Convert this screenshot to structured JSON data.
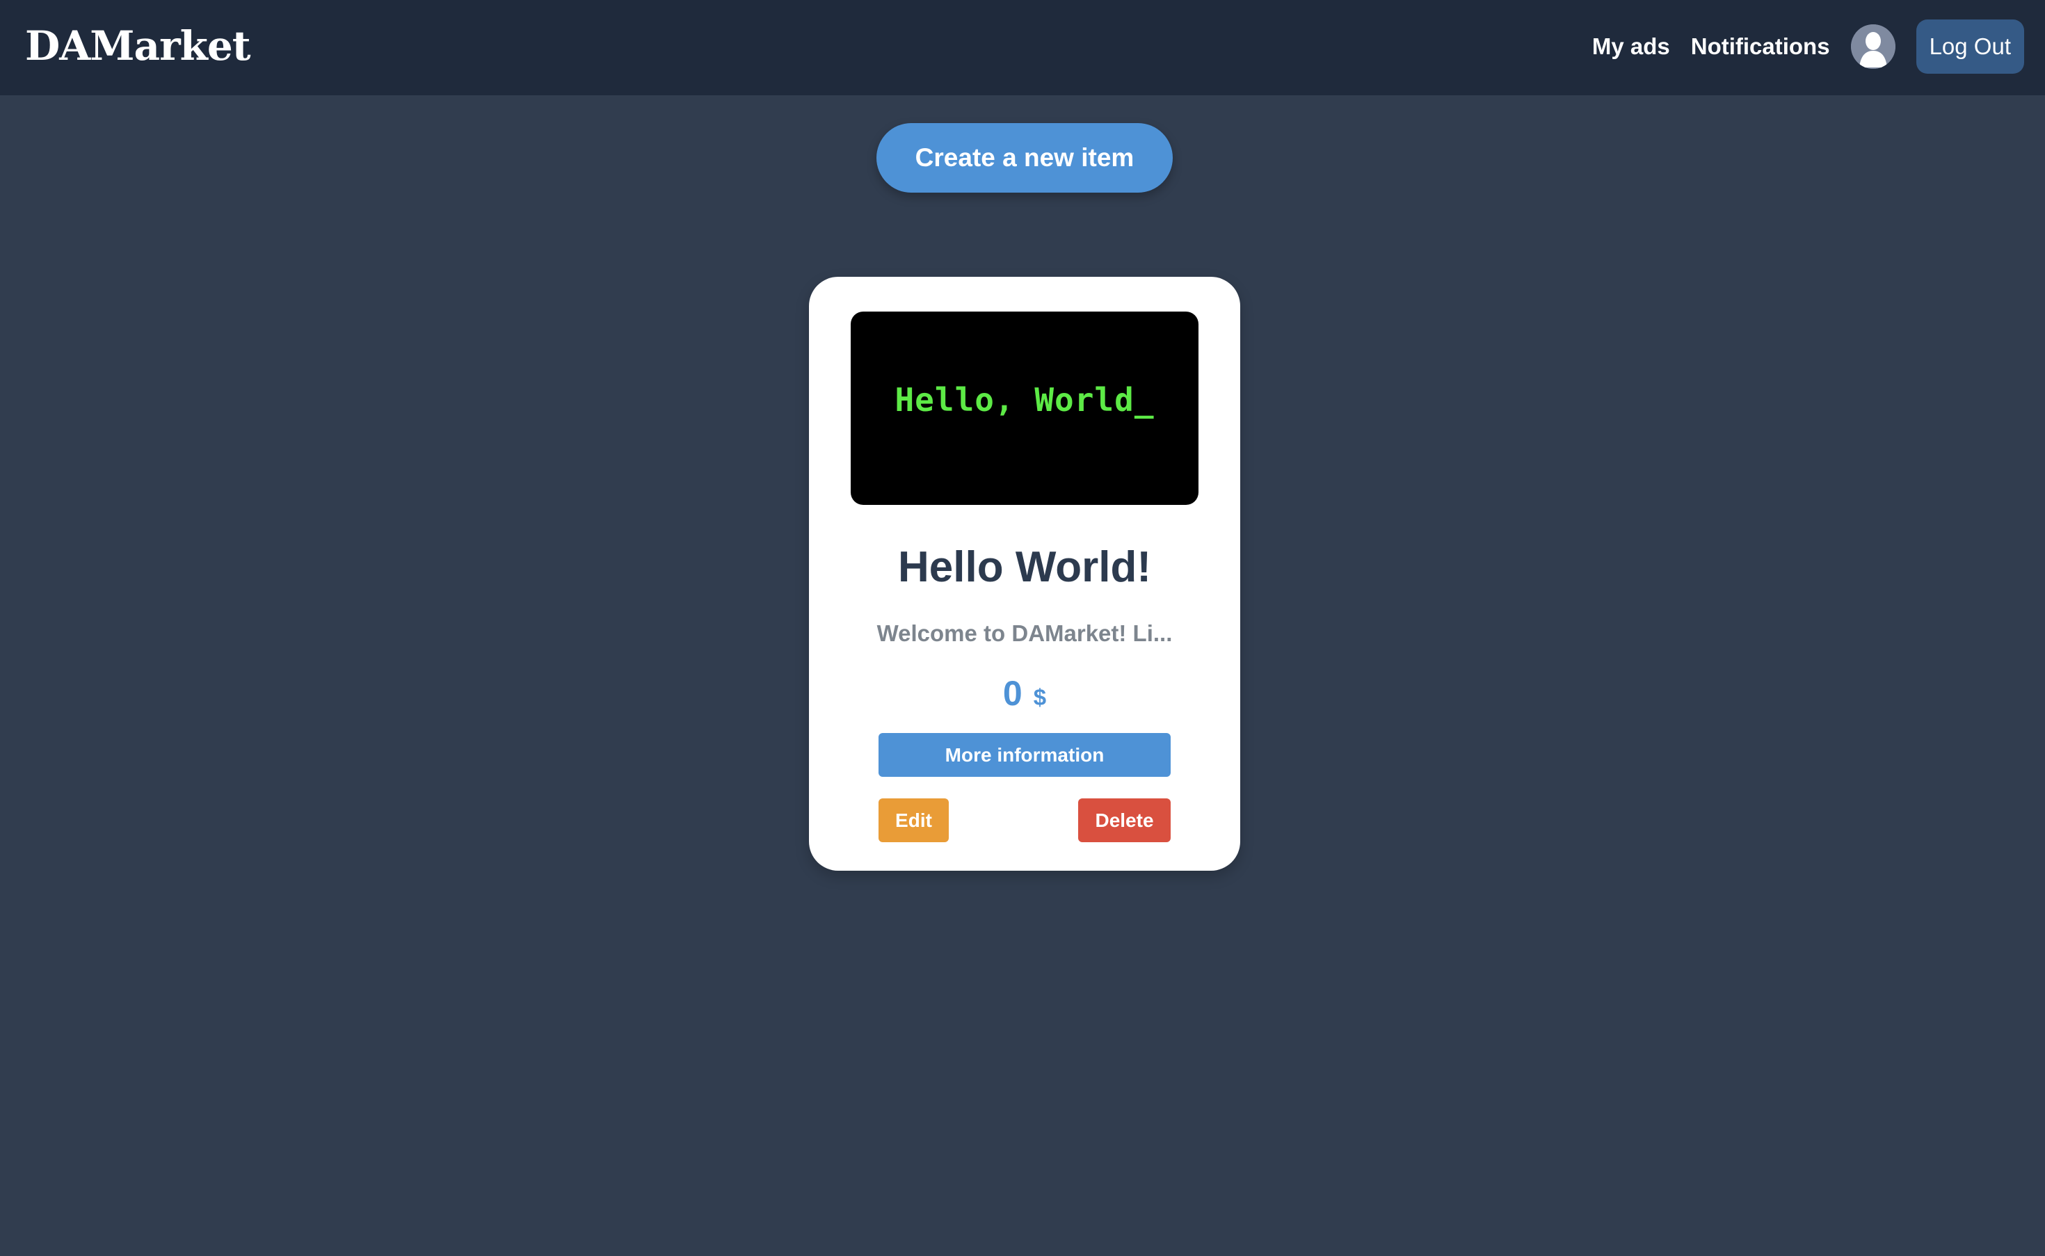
{
  "navbar": {
    "brand": "DAMarket",
    "links": {
      "my_ads": "My ads",
      "notifications": "Notifications"
    },
    "avatar_icon": "user-avatar-icon",
    "logout_label": "Log Out"
  },
  "actions": {
    "create_label": "Create a new item"
  },
  "item": {
    "image_text": "Hello, World_",
    "title": "Hello World!",
    "description": "Welcome to DAMarket! Li...",
    "price": "0",
    "currency": "$",
    "more_label": "More information",
    "edit_label": "Edit",
    "delete_label": "Delete"
  },
  "colors": {
    "page_background": "#313d4f",
    "navbar_background": "#1f2a3c",
    "primary": "#4e92d6",
    "edit": "#e99c37",
    "delete": "#d9503f",
    "logout": "#355a86"
  }
}
